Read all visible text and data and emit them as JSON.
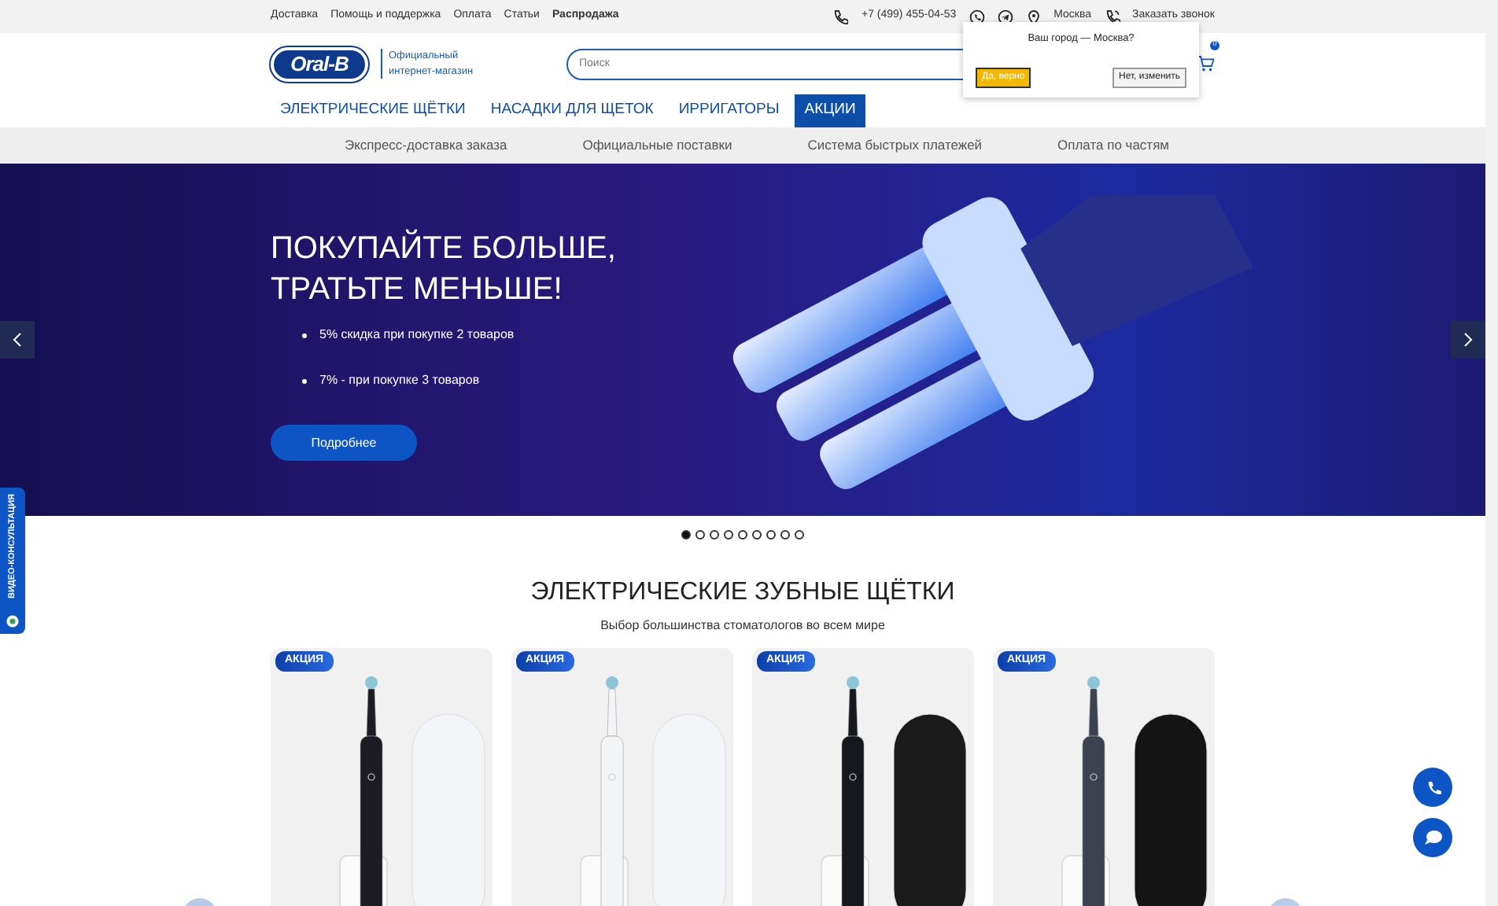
{
  "top_links": [
    {
      "label": "Доставка",
      "bold": false
    },
    {
      "label": "Помощь и поддержка",
      "bold": false
    },
    {
      "label": "Оплата",
      "bold": false
    },
    {
      "label": "Статьи",
      "bold": false
    },
    {
      "label": "Распродажа",
      "bold": true
    }
  ],
  "phone": "+7 (499) 455-04-53",
  "city": "Москва",
  "callback": "Заказать звонок",
  "logo": {
    "brand": "Oral-B",
    "tagline": "Официальный интернет-магазин"
  },
  "search": {
    "placeholder": "Поиск"
  },
  "cart": {
    "count": "0"
  },
  "city_popup": {
    "question": "Ваш город — Москва?",
    "confirm": "Да, верно",
    "change": "Нет, изменить"
  },
  "menu": [
    {
      "label": "ЭЛЕКТРИЧЕСКИЕ ЩЁТКИ",
      "selected": false
    },
    {
      "label": "НАСАДКИ ДЛЯ ЩЕТОК",
      "selected": false
    },
    {
      "label": "ИРРИГАТОРЫ",
      "selected": false
    },
    {
      "label": "АКЦИИ",
      "selected": true
    }
  ],
  "benefits": [
    "Экспресс-доставка заказа",
    "Официальные поставки",
    "Система быстрых платежей",
    "Оплата по частям"
  ],
  "hero": {
    "title": "ПОКУПАЙТЕ БОЛЬШЕ, ТРАТЬТЕ МЕНЬШЕ!",
    "bullets": [
      "5% скидка при покупке 2 товаров",
      "7% - при покупке 3 товаров"
    ],
    "button": "Подробнее"
  },
  "slides": [
    {
      "selected": true
    },
    {
      "selected": false
    },
    {
      "selected": false
    },
    {
      "selected": false
    },
    {
      "selected": false
    },
    {
      "selected": false
    },
    {
      "selected": false
    },
    {
      "selected": false
    },
    {
      "selected": false
    }
  ],
  "section": {
    "title": "ЭЛЕКТРИЧЕСКИЕ ЗУБНЫЕ ЩЁТКИ",
    "subtitle": "Выбор большинства стоматологов во всем мире"
  },
  "products": [
    {
      "badge": "АКЦИЯ",
      "kind": "black-white"
    },
    {
      "badge": "АКЦИЯ",
      "kind": "white"
    },
    {
      "badge": "АКЦИЯ",
      "kind": "black"
    },
    {
      "badge": "АКЦИЯ",
      "kind": "grey"
    }
  ],
  "video_tab": {
    "label": "ВИДЕО-КОНСУЛЬТАЦИЯ"
  }
}
